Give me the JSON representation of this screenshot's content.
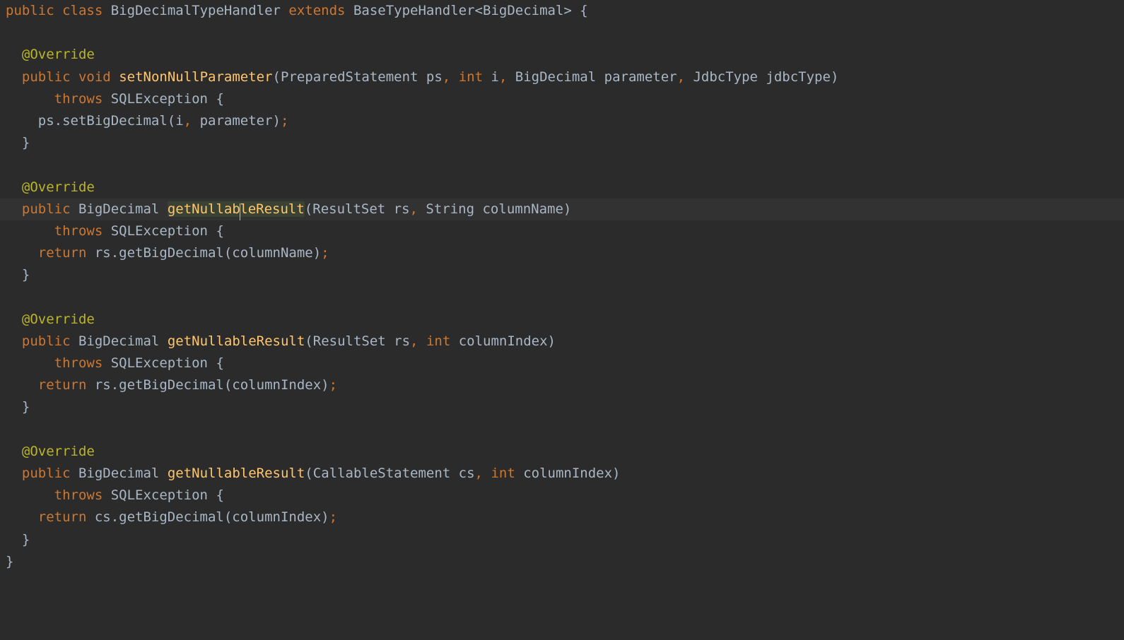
{
  "colors": {
    "background": "#2b2b2b",
    "keyword": "#cc7832",
    "method": "#ffc66d",
    "annotation": "#bbb529",
    "default": "#a9b7c6",
    "lineHighlight": "#323232",
    "selectionBg": "#3a4233"
  },
  "caret": {
    "line": 9,
    "col_after_token": "getNullab"
  },
  "highlighted_line_index": 9,
  "selected_identifier": "getNullableResult",
  "code": [
    {
      "indent": 0,
      "t": [
        {
          "c": "kw",
          "s": "public"
        },
        {
          "c": "plain",
          "s": " "
        },
        {
          "c": "kw",
          "s": "class"
        },
        {
          "c": "plain",
          "s": " "
        },
        {
          "c": "plain",
          "s": "BigDecimalTypeHandler"
        },
        {
          "c": "plain",
          "s": " "
        },
        {
          "c": "kw",
          "s": "extends"
        },
        {
          "c": "plain",
          "s": " "
        },
        {
          "c": "plain",
          "s": "BaseTypeHandler"
        },
        {
          "c": "punct",
          "s": "<"
        },
        {
          "c": "plain",
          "s": "BigDecimal"
        },
        {
          "c": "punct",
          "s": ">"
        },
        {
          "c": "plain",
          "s": " "
        },
        {
          "c": "punct",
          "s": "{"
        }
      ]
    },
    {
      "indent": 0,
      "t": []
    },
    {
      "indent": 1,
      "t": [
        {
          "c": "ann",
          "s": "@Override"
        }
      ]
    },
    {
      "indent": 1,
      "t": [
        {
          "c": "kw",
          "s": "public"
        },
        {
          "c": "plain",
          "s": " "
        },
        {
          "c": "kw",
          "s": "void"
        },
        {
          "c": "plain",
          "s": " "
        },
        {
          "c": "method",
          "s": "setNonNullParameter"
        },
        {
          "c": "punct",
          "s": "("
        },
        {
          "c": "plain",
          "s": "PreparedStatement ps"
        },
        {
          "c": "comma",
          "s": ","
        },
        {
          "c": "plain",
          "s": " "
        },
        {
          "c": "kw",
          "s": "int"
        },
        {
          "c": "plain",
          "s": " i"
        },
        {
          "c": "comma",
          "s": ","
        },
        {
          "c": "plain",
          "s": " BigDecimal parameter"
        },
        {
          "c": "comma",
          "s": ","
        },
        {
          "c": "plain",
          "s": " JdbcType jdbcType"
        },
        {
          "c": "punct",
          "s": ")"
        }
      ]
    },
    {
      "indent": 3,
      "t": [
        {
          "c": "kw",
          "s": "throws"
        },
        {
          "c": "plain",
          "s": " SQLException "
        },
        {
          "c": "punct",
          "s": "{"
        }
      ]
    },
    {
      "indent": 2,
      "t": [
        {
          "c": "plain",
          "s": "ps.setBigDecimal(i"
        },
        {
          "c": "comma",
          "s": ","
        },
        {
          "c": "plain",
          "s": " parameter)"
        },
        {
          "c": "semi",
          "s": ";"
        }
      ]
    },
    {
      "indent": 1,
      "t": [
        {
          "c": "punct",
          "s": "}"
        }
      ]
    },
    {
      "indent": 0,
      "t": []
    },
    {
      "indent": 1,
      "t": [
        {
          "c": "ann",
          "s": "@Override"
        }
      ]
    },
    {
      "indent": 1,
      "hl": true,
      "t": [
        {
          "c": "kw",
          "s": "public"
        },
        {
          "c": "plain",
          "s": " "
        },
        {
          "c": "plain",
          "s": "BigDecimal"
        },
        {
          "c": "plain",
          "s": " "
        },
        {
          "c": "method",
          "s": "getNullab",
          "sel": true
        },
        {
          "caret": true
        },
        {
          "c": "method",
          "s": "leResult",
          "sel": true
        },
        {
          "c": "punct",
          "s": "("
        },
        {
          "c": "plain",
          "s": "ResultSet rs"
        },
        {
          "c": "comma",
          "s": ","
        },
        {
          "c": "plain",
          "s": " String columnName"
        },
        {
          "c": "punct",
          "s": ")"
        }
      ]
    },
    {
      "indent": 3,
      "t": [
        {
          "c": "kw",
          "s": "throws"
        },
        {
          "c": "plain",
          "s": " SQLException "
        },
        {
          "c": "punct",
          "s": "{"
        }
      ]
    },
    {
      "indent": 2,
      "t": [
        {
          "c": "kw",
          "s": "return"
        },
        {
          "c": "plain",
          "s": " rs.getBigDecimal(columnName)"
        },
        {
          "c": "semi",
          "s": ";"
        }
      ]
    },
    {
      "indent": 1,
      "t": [
        {
          "c": "punct",
          "s": "}"
        }
      ]
    },
    {
      "indent": 0,
      "t": []
    },
    {
      "indent": 1,
      "t": [
        {
          "c": "ann",
          "s": "@Override"
        }
      ]
    },
    {
      "indent": 1,
      "t": [
        {
          "c": "kw",
          "s": "public"
        },
        {
          "c": "plain",
          "s": " "
        },
        {
          "c": "plain",
          "s": "BigDecimal"
        },
        {
          "c": "plain",
          "s": " "
        },
        {
          "c": "method",
          "s": "getNullableResult"
        },
        {
          "c": "punct",
          "s": "("
        },
        {
          "c": "plain",
          "s": "ResultSet rs"
        },
        {
          "c": "comma",
          "s": ","
        },
        {
          "c": "plain",
          "s": " "
        },
        {
          "c": "kw",
          "s": "int"
        },
        {
          "c": "plain",
          "s": " columnIndex"
        },
        {
          "c": "punct",
          "s": ")"
        }
      ]
    },
    {
      "indent": 3,
      "t": [
        {
          "c": "kw",
          "s": "throws"
        },
        {
          "c": "plain",
          "s": " SQLException "
        },
        {
          "c": "punct",
          "s": "{"
        }
      ]
    },
    {
      "indent": 2,
      "t": [
        {
          "c": "kw",
          "s": "return"
        },
        {
          "c": "plain",
          "s": " rs.getBigDecimal(columnIndex)"
        },
        {
          "c": "semi",
          "s": ";"
        }
      ]
    },
    {
      "indent": 1,
      "t": [
        {
          "c": "punct",
          "s": "}"
        }
      ]
    },
    {
      "indent": 0,
      "t": []
    },
    {
      "indent": 1,
      "t": [
        {
          "c": "ann",
          "s": "@Override"
        }
      ]
    },
    {
      "indent": 1,
      "t": [
        {
          "c": "kw",
          "s": "public"
        },
        {
          "c": "plain",
          "s": " "
        },
        {
          "c": "plain",
          "s": "BigDecimal"
        },
        {
          "c": "plain",
          "s": " "
        },
        {
          "c": "method",
          "s": "getNullableResult"
        },
        {
          "c": "punct",
          "s": "("
        },
        {
          "c": "plain",
          "s": "CallableStatement cs"
        },
        {
          "c": "comma",
          "s": ","
        },
        {
          "c": "plain",
          "s": " "
        },
        {
          "c": "kw",
          "s": "int"
        },
        {
          "c": "plain",
          "s": " columnIndex"
        },
        {
          "c": "punct",
          "s": ")"
        }
      ]
    },
    {
      "indent": 3,
      "t": [
        {
          "c": "kw",
          "s": "throws"
        },
        {
          "c": "plain",
          "s": " SQLException "
        },
        {
          "c": "punct",
          "s": "{"
        }
      ]
    },
    {
      "indent": 2,
      "t": [
        {
          "c": "kw",
          "s": "return"
        },
        {
          "c": "plain",
          "s": " cs.getBigDecimal(columnIndex)"
        },
        {
          "c": "semi",
          "s": ";"
        }
      ]
    },
    {
      "indent": 1,
      "t": [
        {
          "c": "punct",
          "s": "}"
        }
      ]
    },
    {
      "indent": 0,
      "t": [
        {
          "c": "punct",
          "s": "}"
        }
      ]
    }
  ]
}
